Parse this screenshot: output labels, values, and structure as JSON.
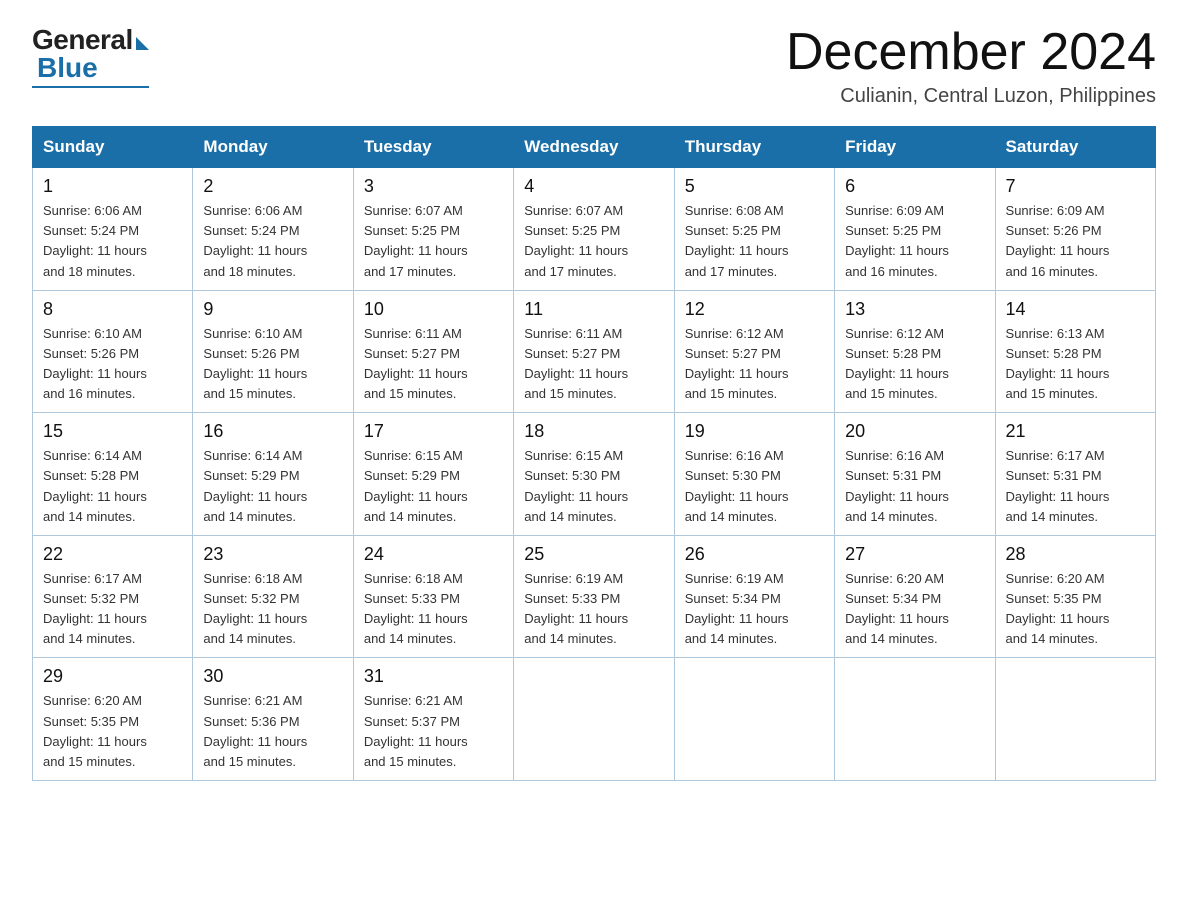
{
  "logo": {
    "general": "General",
    "blue": "Blue"
  },
  "title": {
    "month_year": "December 2024",
    "location": "Culianin, Central Luzon, Philippines"
  },
  "weekdays": [
    "Sunday",
    "Monday",
    "Tuesday",
    "Wednesday",
    "Thursday",
    "Friday",
    "Saturday"
  ],
  "weeks": [
    [
      {
        "day": "1",
        "sunrise": "6:06 AM",
        "sunset": "5:24 PM",
        "daylight": "11 hours and 18 minutes."
      },
      {
        "day": "2",
        "sunrise": "6:06 AM",
        "sunset": "5:24 PM",
        "daylight": "11 hours and 18 minutes."
      },
      {
        "day": "3",
        "sunrise": "6:07 AM",
        "sunset": "5:25 PM",
        "daylight": "11 hours and 17 minutes."
      },
      {
        "day": "4",
        "sunrise": "6:07 AM",
        "sunset": "5:25 PM",
        "daylight": "11 hours and 17 minutes."
      },
      {
        "day": "5",
        "sunrise": "6:08 AM",
        "sunset": "5:25 PM",
        "daylight": "11 hours and 17 minutes."
      },
      {
        "day": "6",
        "sunrise": "6:09 AM",
        "sunset": "5:25 PM",
        "daylight": "11 hours and 16 minutes."
      },
      {
        "day": "7",
        "sunrise": "6:09 AM",
        "sunset": "5:26 PM",
        "daylight": "11 hours and 16 minutes."
      }
    ],
    [
      {
        "day": "8",
        "sunrise": "6:10 AM",
        "sunset": "5:26 PM",
        "daylight": "11 hours and 16 minutes."
      },
      {
        "day": "9",
        "sunrise": "6:10 AM",
        "sunset": "5:26 PM",
        "daylight": "11 hours and 15 minutes."
      },
      {
        "day": "10",
        "sunrise": "6:11 AM",
        "sunset": "5:27 PM",
        "daylight": "11 hours and 15 minutes."
      },
      {
        "day": "11",
        "sunrise": "6:11 AM",
        "sunset": "5:27 PM",
        "daylight": "11 hours and 15 minutes."
      },
      {
        "day": "12",
        "sunrise": "6:12 AM",
        "sunset": "5:27 PM",
        "daylight": "11 hours and 15 minutes."
      },
      {
        "day": "13",
        "sunrise": "6:12 AM",
        "sunset": "5:28 PM",
        "daylight": "11 hours and 15 minutes."
      },
      {
        "day": "14",
        "sunrise": "6:13 AM",
        "sunset": "5:28 PM",
        "daylight": "11 hours and 15 minutes."
      }
    ],
    [
      {
        "day": "15",
        "sunrise": "6:14 AM",
        "sunset": "5:28 PM",
        "daylight": "11 hours and 14 minutes."
      },
      {
        "day": "16",
        "sunrise": "6:14 AM",
        "sunset": "5:29 PM",
        "daylight": "11 hours and 14 minutes."
      },
      {
        "day": "17",
        "sunrise": "6:15 AM",
        "sunset": "5:29 PM",
        "daylight": "11 hours and 14 minutes."
      },
      {
        "day": "18",
        "sunrise": "6:15 AM",
        "sunset": "5:30 PM",
        "daylight": "11 hours and 14 minutes."
      },
      {
        "day": "19",
        "sunrise": "6:16 AM",
        "sunset": "5:30 PM",
        "daylight": "11 hours and 14 minutes."
      },
      {
        "day": "20",
        "sunrise": "6:16 AM",
        "sunset": "5:31 PM",
        "daylight": "11 hours and 14 minutes."
      },
      {
        "day": "21",
        "sunrise": "6:17 AM",
        "sunset": "5:31 PM",
        "daylight": "11 hours and 14 minutes."
      }
    ],
    [
      {
        "day": "22",
        "sunrise": "6:17 AM",
        "sunset": "5:32 PM",
        "daylight": "11 hours and 14 minutes."
      },
      {
        "day": "23",
        "sunrise": "6:18 AM",
        "sunset": "5:32 PM",
        "daylight": "11 hours and 14 minutes."
      },
      {
        "day": "24",
        "sunrise": "6:18 AM",
        "sunset": "5:33 PM",
        "daylight": "11 hours and 14 minutes."
      },
      {
        "day": "25",
        "sunrise": "6:19 AM",
        "sunset": "5:33 PM",
        "daylight": "11 hours and 14 minutes."
      },
      {
        "day": "26",
        "sunrise": "6:19 AM",
        "sunset": "5:34 PM",
        "daylight": "11 hours and 14 minutes."
      },
      {
        "day": "27",
        "sunrise": "6:20 AM",
        "sunset": "5:34 PM",
        "daylight": "11 hours and 14 minutes."
      },
      {
        "day": "28",
        "sunrise": "6:20 AM",
        "sunset": "5:35 PM",
        "daylight": "11 hours and 14 minutes."
      }
    ],
    [
      {
        "day": "29",
        "sunrise": "6:20 AM",
        "sunset": "5:35 PM",
        "daylight": "11 hours and 15 minutes."
      },
      {
        "day": "30",
        "sunrise": "6:21 AM",
        "sunset": "5:36 PM",
        "daylight": "11 hours and 15 minutes."
      },
      {
        "day": "31",
        "sunrise": "6:21 AM",
        "sunset": "5:37 PM",
        "daylight": "11 hours and 15 minutes."
      },
      null,
      null,
      null,
      null
    ]
  ]
}
